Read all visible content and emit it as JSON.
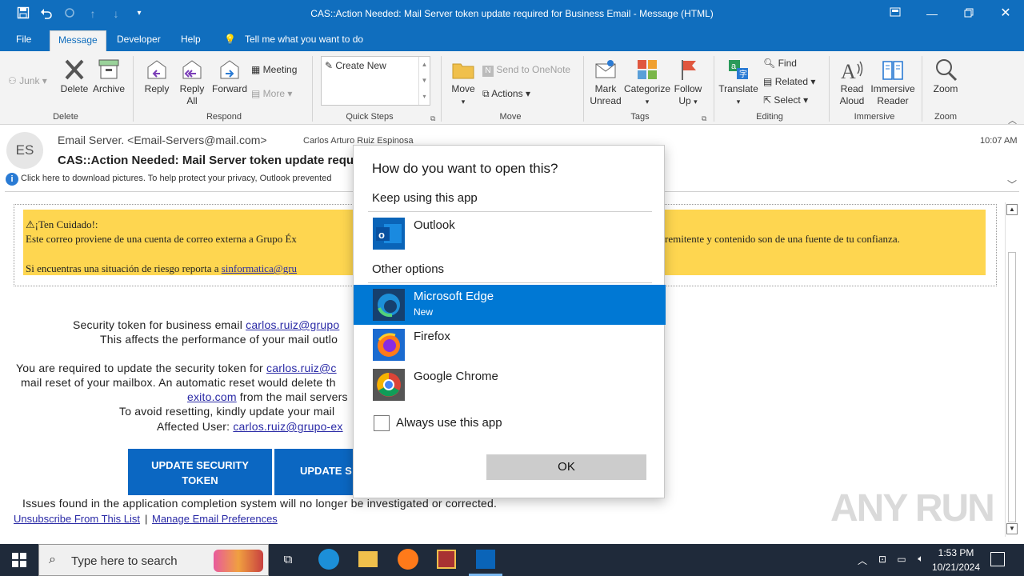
{
  "window": {
    "title": "CAS::Action Needed: Mail Server token update required for Business Email  -  Message (HTML)"
  },
  "menu": {
    "tabs": [
      "File",
      "Message",
      "Developer",
      "Help"
    ],
    "tell_me": "Tell me what you want to do"
  },
  "ribbon": {
    "junk": "Junk",
    "delete": "Delete",
    "archive": "Archive",
    "group_delete": "Delete",
    "reply": "Reply",
    "reply_all_1": "Reply",
    "reply_all_2": "All",
    "forward": "Forward",
    "meeting": "Meeting",
    "more": "More",
    "group_respond": "Respond",
    "create_new": "Create New",
    "group_quick_steps": "Quick Steps",
    "move": "Move",
    "send_onenote": "Send to OneNote",
    "actions": "Actions",
    "group_move": "Move",
    "mark_unread_1": "Mark",
    "mark_unread_2": "Unread",
    "categorize": "Categorize",
    "follow_up_1": "Follow",
    "follow_up_2": "Up",
    "group_tags": "Tags",
    "translate": "Translate",
    "find": "Find",
    "related": "Related",
    "select": "Select",
    "group_editing": "Editing",
    "read_aloud_1": "Read",
    "read_aloud_2": "Aloud",
    "immersive_1": "Immersive",
    "immersive_2": "Reader",
    "group_immersive": "Immersive",
    "zoom": "Zoom",
    "group_zoom": "Zoom"
  },
  "header": {
    "avatar": "ES",
    "from": "Email Server. <Email-Servers@mail.com>",
    "to": "Carlos Arturo Ruiz Espinosa",
    "time": "10:07 AM",
    "subject": "CAS::Action Needed: Mail Server token update require",
    "info": "Click here to download pictures. To help protect your privacy, Outlook prevented"
  },
  "email": {
    "warn_title": "¡Ten Cuidado!:",
    "warn_line1a": "Este correo proviene de una cuenta de correo externa a Grupo Éx",
    "warn_line1b": "remitente y contenido son de una fuente de tu confianza.",
    "warn_line2": "Si encuentras una situación de riesgo reporta a ",
    "warn_link": "sinformatica@gru",
    "l1a": "Security token for business  email  ",
    "l1link": "carlos.ruiz@grupo",
    "l2": "This affects the performance  of your mail outlo",
    "l3a": "You are required  to update the security token for ",
    "l3link": "carlos.ruiz@c",
    "l4": "mail reset of your mailbox.  An automatic reset would delete  th",
    "l5link": "exito.com",
    "l5b": " from the mail servers",
    "l6": "To avoid resetting,  kindly update your mail",
    "l7a": "Affected User: ",
    "l7link": "carlos.ruiz@grupo-ex",
    "btn1_1": "UPDATE SECURITY",
    "btn1_2": "TOKEN",
    "btn2": "UPDATE S",
    "l8": "Issues  found in the  application  completion  system  will  no longer  be investigated  or corrected.",
    "unsub": "Unsubscribe From This List",
    "sep": "|",
    "prefs": "Manage Email Preferences"
  },
  "dialog": {
    "title": "How do you want to open this?",
    "keep": "Keep using this app",
    "outlook": "Outlook",
    "other": "Other options",
    "apps": [
      {
        "name": "Microsoft Edge",
        "sub": "New"
      },
      {
        "name": "Firefox",
        "sub": ""
      },
      {
        "name": "Google Chrome",
        "sub": ""
      }
    ],
    "always": "Always use this app",
    "ok": "OK"
  },
  "taskbar": {
    "search": "Type here to search",
    "time": "1:53 PM",
    "date": "10/21/2024"
  },
  "watermark": "ANY RUN"
}
